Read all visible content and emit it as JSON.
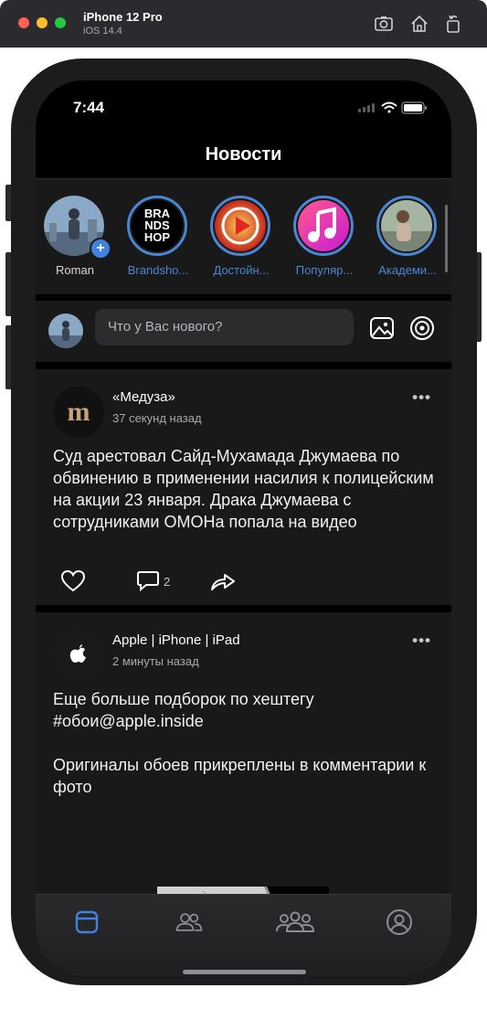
{
  "simulator": {
    "device_name": "iPhone 12 Pro",
    "os_version": "iOS 14.4",
    "tools": [
      "screenshot-icon",
      "home-icon",
      "rotate-icon"
    ]
  },
  "status_bar": {
    "time": "7:44"
  },
  "nav": {
    "title": "Новости"
  },
  "stories": [
    {
      "label": "Roman",
      "self": true
    },
    {
      "label": "Brandsho...",
      "self": false,
      "logo_text": "BRA\nNDS\nHOP"
    },
    {
      "label": "Достойн...",
      "self": false
    },
    {
      "label": "Популяр...",
      "self": false
    },
    {
      "label": "Академи...",
      "self": false
    }
  ],
  "composer": {
    "placeholder": "Что у Вас нового?",
    "icons": [
      "photo-icon",
      "target-icon"
    ]
  },
  "posts": [
    {
      "author": "«Медуза»",
      "time": "37 секунд назад",
      "text": "Суд арестовал Сайд-Мухамада Джумаева по обвинению в применении насилия к полицейским на акции 23 января. Драка Джумаева с сотрудниками ОМОНа попала на видео",
      "comments_count": "2",
      "avatar_letter": "m"
    },
    {
      "author": "Apple | iPhone | iPad",
      "time": "2 минуты назад",
      "text": "Еще больше подборок по хештегу #обои@apple.inside\n\nОригиналы обоев прикреплены в комментарии к фото"
    }
  ],
  "tabbar": {
    "items": [
      "news-tab-icon",
      "friends-tab-icon",
      "groups-tab-icon",
      "profile-tab-icon"
    ],
    "active": 0
  },
  "colors": {
    "accent": "#4a86d4",
    "background": "#000000",
    "card": "#19191a",
    "text": "#f2f2f2",
    "secondary_text": "#a9a9ad"
  }
}
